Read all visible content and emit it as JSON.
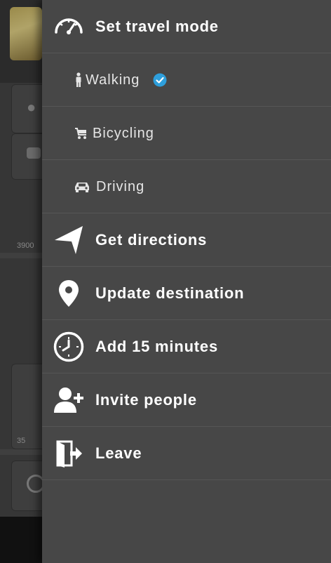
{
  "background": {
    "labels": [
      "3900",
      "35"
    ]
  },
  "menu": {
    "items": [
      {
        "label": "Set travel mode",
        "icon": "speedometer-icon"
      },
      {
        "label": "Walking",
        "icon": "walking-person-icon",
        "selected": true
      },
      {
        "label": "Bicycling",
        "icon": "bicycle-icon"
      },
      {
        "label": "Driving",
        "icon": "car-icon"
      },
      {
        "label": "Get directions",
        "icon": "navigation-arrow-icon"
      },
      {
        "label": "Update destination",
        "icon": "location-pin-icon"
      },
      {
        "label": "Add 15 minutes",
        "icon": "clock-icon"
      },
      {
        "label": "Invite people",
        "icon": "add-person-icon"
      },
      {
        "label": "Leave",
        "icon": "exit-door-icon"
      }
    ]
  },
  "colors": {
    "menu_bg": "#474747",
    "divider": "#565656",
    "check": "#2e9fdc",
    "text": "#ffffff"
  }
}
